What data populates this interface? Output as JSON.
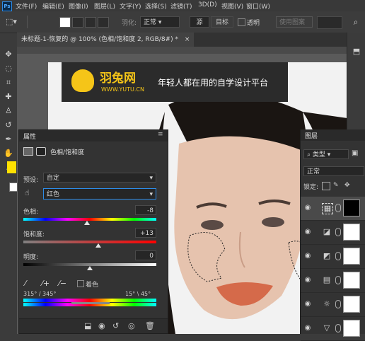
{
  "app": {
    "logo": "Ps"
  },
  "menu": [
    "文件(F)",
    "编辑(E)",
    "图像(I)",
    "图层(L)",
    "文字(Y)",
    "选择(S)",
    "滤镜(T)",
    "3D(D)",
    "视图(V)",
    "窗口(W)"
  ],
  "options": {
    "feather_label": "羽化:",
    "style_label": "正常",
    "btn_source": "源",
    "btn_target": "目标",
    "transparent_label": "透明",
    "use_pattern_label": "使用图案"
  },
  "document_tab": {
    "title": "未标题-1-恢复的 @ 100% (色相/饱和度 2, RGB/8#) *",
    "close": "×"
  },
  "banner": {
    "brand": "羽兔网",
    "url": "WWW.YUTU.CN",
    "slogan": "年轻人都在用的自学设计平台"
  },
  "properties": {
    "panel_title": "属性",
    "adjustment_name": "色相/饱和度",
    "preset_label": "预设:",
    "preset_value": "自定",
    "channel_value": "红色",
    "hue_label": "色相:",
    "hue_value": "-8",
    "hue_level": -8,
    "saturation_label": "饱和度:",
    "saturation_value": "+13",
    "saturation_level": 13,
    "lightness_label": "明度:",
    "lightness_value": "0",
    "lightness_level": 0,
    "colorize_label": "着色",
    "range_left": "315° / 345°",
    "range_right": "15° \\ 45°"
  },
  "layers": {
    "panel_title": "图层",
    "kind_label": "类型",
    "blend_mode": "正常",
    "lock_label": "锁定:"
  },
  "colors": {
    "foreground": "#ffe100",
    "background": "#ffffff",
    "accent": "#2d8ce8"
  }
}
